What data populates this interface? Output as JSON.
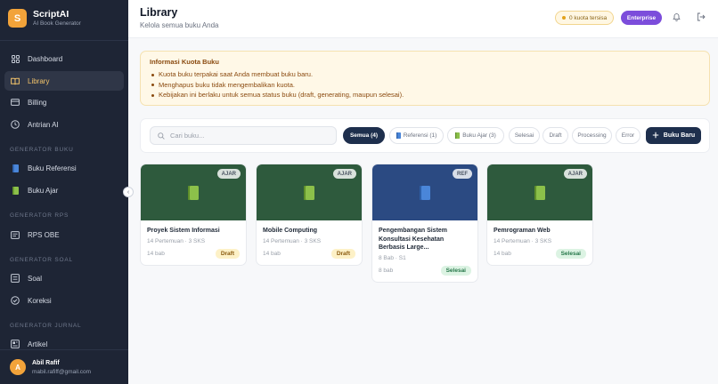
{
  "brand": {
    "name": "ScriptAI",
    "subtitle": "AI Book Generator",
    "logo_letter": "S",
    "accent": "#f2a33a"
  },
  "sidebar": {
    "items": [
      {
        "label": "Dashboard",
        "icon": "grid-icon"
      },
      {
        "label": "Library",
        "icon": "book-open-icon",
        "active": true
      },
      {
        "label": "Billing",
        "icon": "credit-card-icon"
      },
      {
        "label": "Antrian AI",
        "icon": "clock-icon"
      }
    ],
    "sections": [
      {
        "title": "GENERATOR BUKU",
        "items": [
          {
            "label": "Buku Referensi",
            "icon": "blue-book-icon"
          },
          {
            "label": "Buku Ajar",
            "icon": "green-book-icon"
          }
        ]
      },
      {
        "title": "GENERATOR RPS",
        "items": [
          {
            "label": "RPS OBE",
            "icon": "document-icon"
          }
        ]
      },
      {
        "title": "GENERATOR SOAL",
        "items": [
          {
            "label": "Soal",
            "icon": "list-icon"
          },
          {
            "label": "Koreksi",
            "icon": "check-circle-icon"
          }
        ]
      },
      {
        "title": "GENERATOR JURNAL",
        "items": [
          {
            "label": "Artikel",
            "icon": "newspaper-icon"
          }
        ]
      }
    ]
  },
  "user": {
    "initial": "A",
    "name": "Abil Rafif",
    "email": "mabil.rafiff@gmail.com"
  },
  "header": {
    "title": "Library",
    "subtitle": "Kelola semua buku Anda",
    "quota": "0 kuota tersisa",
    "plan_button": "Enterprise",
    "plan_color": "#7c4ddb"
  },
  "info": {
    "title": "Informasi Kuota Buku",
    "points": [
      "Kuota buku terpakai saat Anda membuat buku baru.",
      "Menghapus buku tidak mengembalikan kuota.",
      "Kebijakan ini berlaku untuk semua status buku (draft, generating, maupun selesai)."
    ]
  },
  "toolbar": {
    "search_placeholder": "Cari buku...",
    "filters": [
      {
        "label": "Semua (4)",
        "active": true
      },
      {
        "label": "Referensi (1)",
        "icon": "blue-book-icon"
      },
      {
        "label": "Buku Ajar (3)",
        "icon": "green-book-icon"
      },
      {
        "label": "Selesai"
      },
      {
        "label": "Draft"
      },
      {
        "label": "Processing"
      },
      {
        "label": "Error"
      }
    ],
    "new_book_label": "Buku Baru"
  },
  "books": [
    {
      "badge": "AJAR",
      "title": "Proyek Sistem Informasi",
      "meta": "14 Pertemuan · 3 SKS",
      "chapters": "14 bab",
      "status": "Draft",
      "cover": "green"
    },
    {
      "badge": "AJAR",
      "title": "Mobile Computing",
      "meta": "14 Pertemuan · 3 SKS",
      "chapters": "14 bab",
      "status": "Draft",
      "cover": "green"
    },
    {
      "badge": "REF",
      "title": "Pengembangan Sistem Konsultasi Kesehatan Berbasis Large...",
      "meta": "8 Bab · S1",
      "chapters": "8 bab",
      "status": "Selesai",
      "cover": "blue"
    },
    {
      "badge": "AJAR",
      "title": "Pemrograman Web",
      "meta": "14 Pertemuan · 3 SKS",
      "chapters": "14 bab",
      "status": "Selesai",
      "cover": "green"
    }
  ]
}
